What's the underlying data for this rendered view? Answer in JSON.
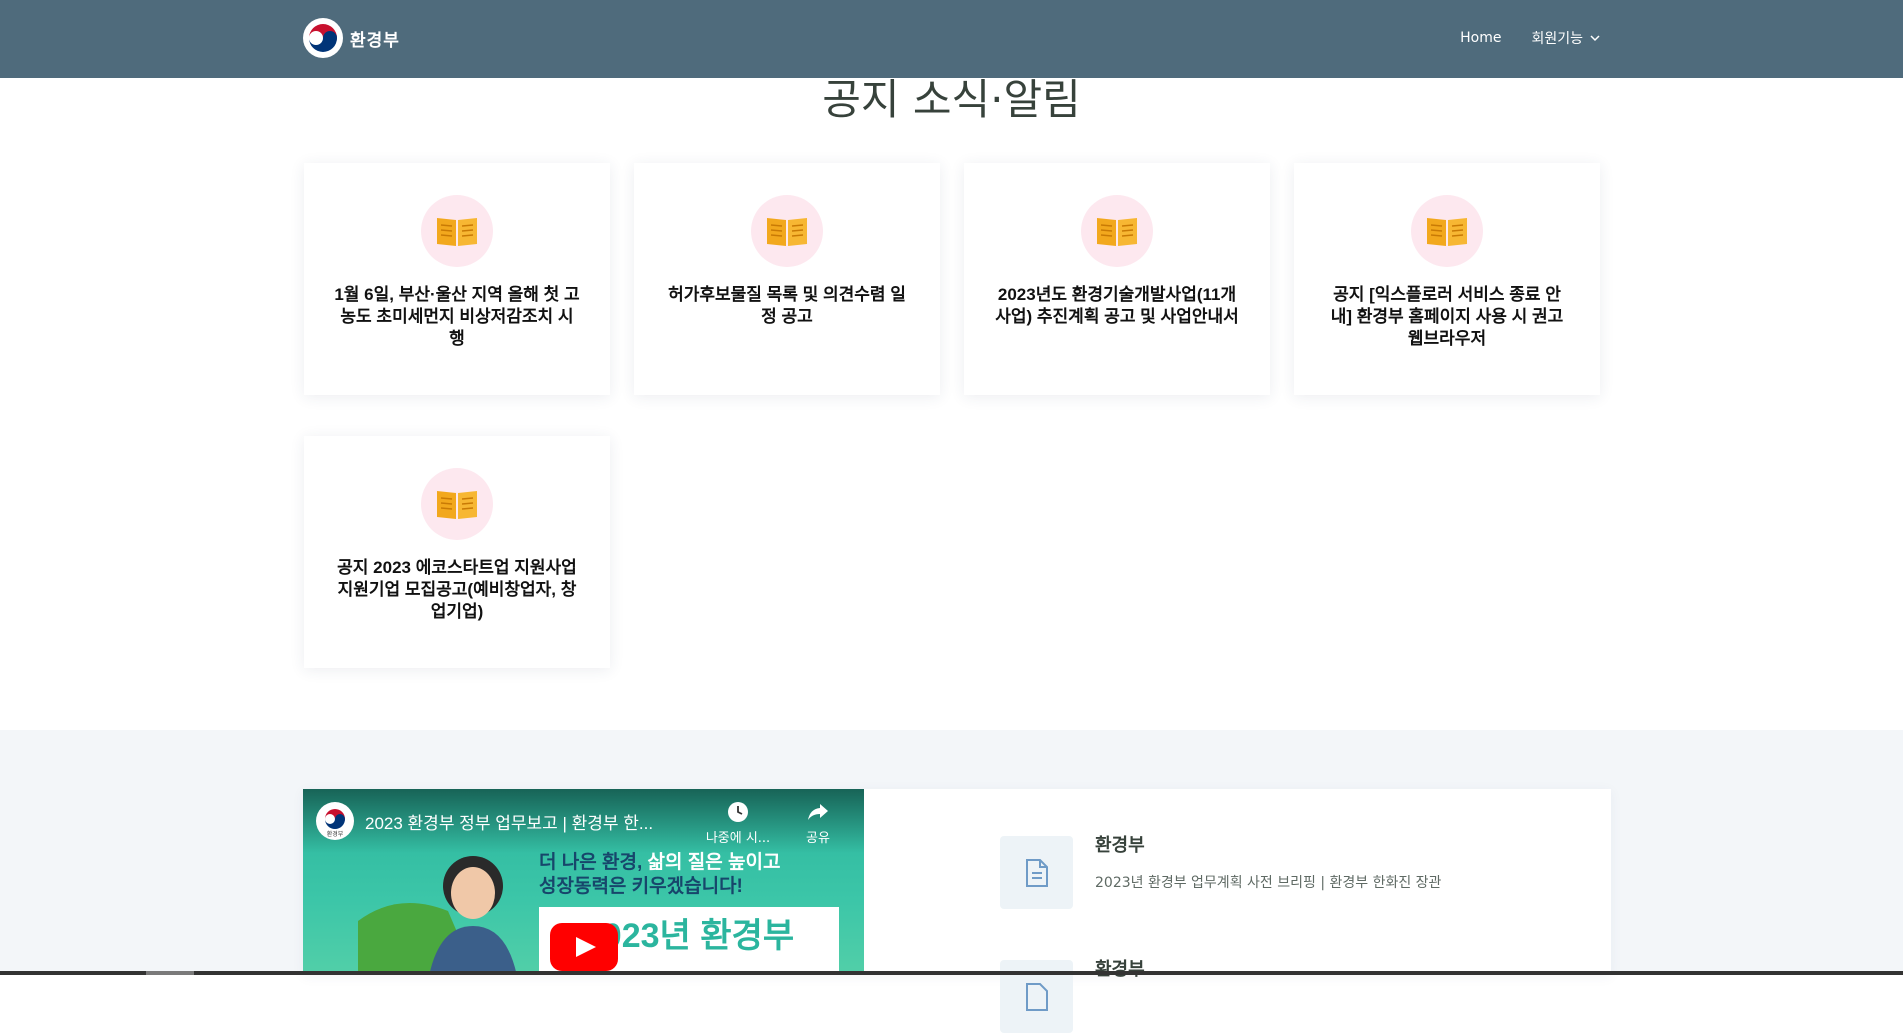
{
  "header": {
    "logo_text": "환경부",
    "nav": [
      {
        "label": "Home"
      },
      {
        "label": "회원기능",
        "icon": "chevron-down-icon"
      }
    ]
  },
  "section": {
    "title": "공지 소식·알림"
  },
  "notices": [
    {
      "icon": "open-book-icon",
      "title": "1월 6일, 부산·울산 지역 올해 첫 고농도 초미세먼지 비상저감조치 시행"
    },
    {
      "icon": "open-book-icon",
      "title": "허가후보물질 목록 및 의견수렴 일정 공고"
    },
    {
      "icon": "open-book-icon",
      "title": "2023년도 환경기술개발사업(11개 사업) 추진계획 공고 및 사업안내서"
    },
    {
      "icon": "open-book-icon",
      "title": "공지 [익스플로러 서비스 종료 안내] 환경부 홈페이지 사용 시 권고 웹브라우저"
    },
    {
      "icon": "open-book-icon",
      "title": "공지 2023 에코스타트업 지원사업 지원기업 모집공고(예비창업자, 창업기업)"
    }
  ],
  "video": {
    "title": "2023 환경부 정부 업무보고 | 환경부 한...",
    "channel_avatar_text": "환경부",
    "watch_later_label": "나중에 시...",
    "share_label": "공유",
    "slogan_line1_a": "더 나은 환경, ",
    "slogan_line1_b": "삶의 질은 높이고",
    "slogan_line2": "성장동력은 키우겠습니다!",
    "badge_text": "2023년 환경부"
  },
  "info_items": [
    {
      "icon": "document-icon",
      "title": "환경부",
      "desc": "2023년 환경부 업무계획 사전 브리핑 | 환경부 한화진 장관"
    },
    {
      "icon": "document-icon",
      "title": "환경부",
      "desc": ""
    }
  ],
  "colors": {
    "header_bg": "#4f6b7c",
    "icon_circle_bg": "#fde8ef",
    "book_icon": "#f2a81d",
    "section_bg": "#f3f6f9",
    "youtube_red": "#ff0000"
  }
}
